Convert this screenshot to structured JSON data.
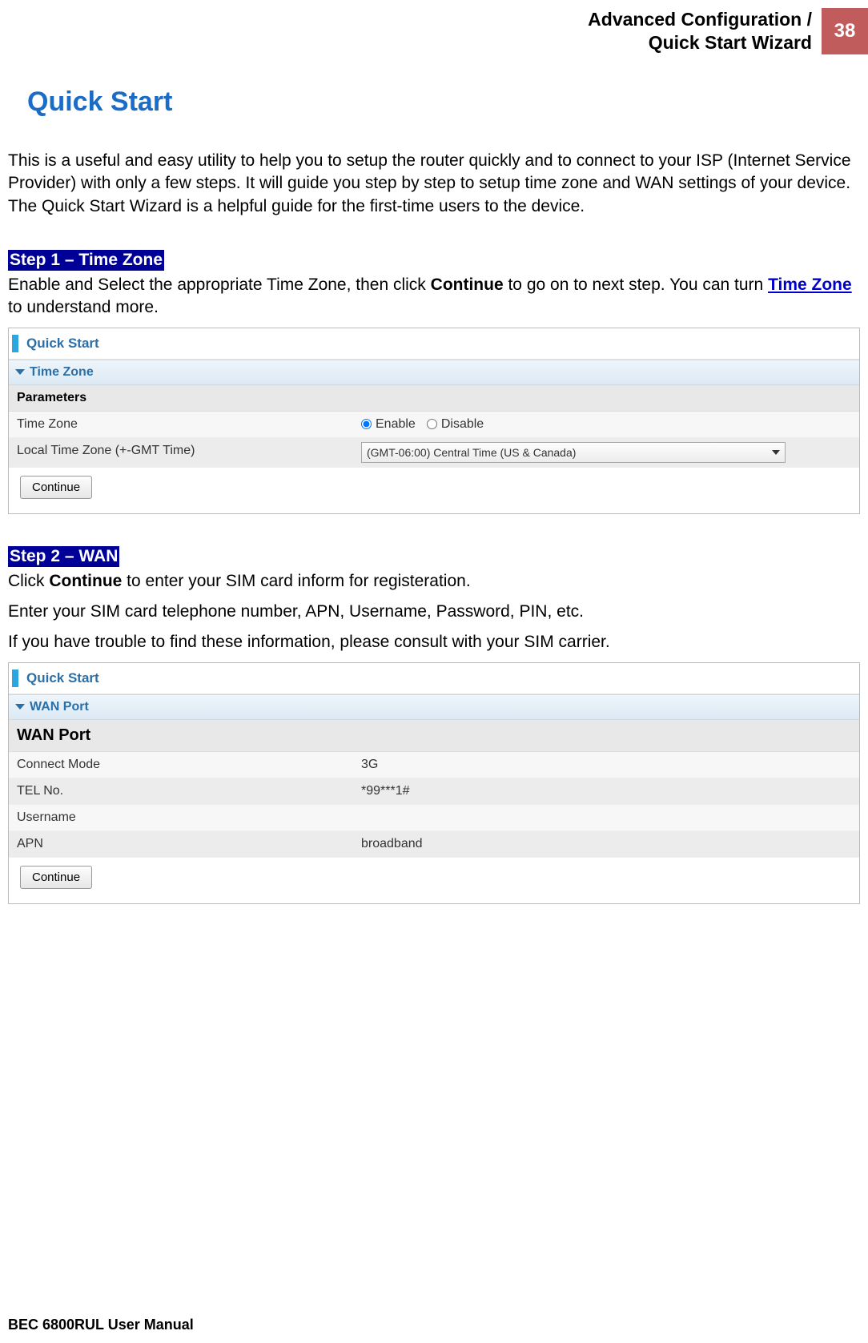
{
  "header": {
    "breadcrumb_line1": "Advanced Configuration /",
    "breadcrumb_line2": "Quick Start Wizard",
    "page_number": "38"
  },
  "title": "Quick Start",
  "intro": "This is a useful and easy utility to help you to setup the router quickly and to connect to your ISP (Internet Service Provider) with only a few steps. It will guide you step by step to setup time zone and WAN settings of your device. The Quick Start Wizard is a helpful guide for the first-time users to the device.",
  "step1": {
    "heading": "Step 1 – Time Zone",
    "desc_pre": "Enable and Select the appropriate Time Zone, then click ",
    "desc_bold": "Continue",
    "desc_mid": " to go on to next step. You can turn ",
    "desc_link": "Time Zone",
    "desc_post": " to understand more.",
    "panel": {
      "title": "Quick Start",
      "section": "Time Zone",
      "params_label": "Parameters",
      "rows": [
        {
          "label": "Time Zone",
          "type": "radio",
          "option1": "Enable",
          "option2": "Disable",
          "selected": "Enable"
        },
        {
          "label": "Local Time Zone (+-GMT Time)",
          "type": "select",
          "value": "(GMT-06:00) Central Time (US & Canada)"
        }
      ],
      "button": "Continue"
    }
  },
  "step2": {
    "heading": "Step 2 – WAN",
    "desc1_pre": "Click ",
    "desc1_bold": "Continue",
    "desc1_post": " to enter your SIM card inform for registeration.",
    "desc2": "Enter your SIM card telephone number, APN, Username, Password, PIN, etc.",
    "desc3": "If you have trouble to find these information, please consult with your SIM carrier.",
    "panel": {
      "title": "Quick Start",
      "section": "WAN Port",
      "port_label": "WAN Port",
      "rows": [
        {
          "label": "Connect Mode",
          "value": "3G"
        },
        {
          "label": "TEL No.",
          "value": "*99***1#"
        },
        {
          "label": "Username",
          "value": ""
        },
        {
          "label": "APN",
          "value": "broadband"
        }
      ],
      "button": "Continue"
    }
  },
  "footer": "BEC 6800RUL User Manual"
}
